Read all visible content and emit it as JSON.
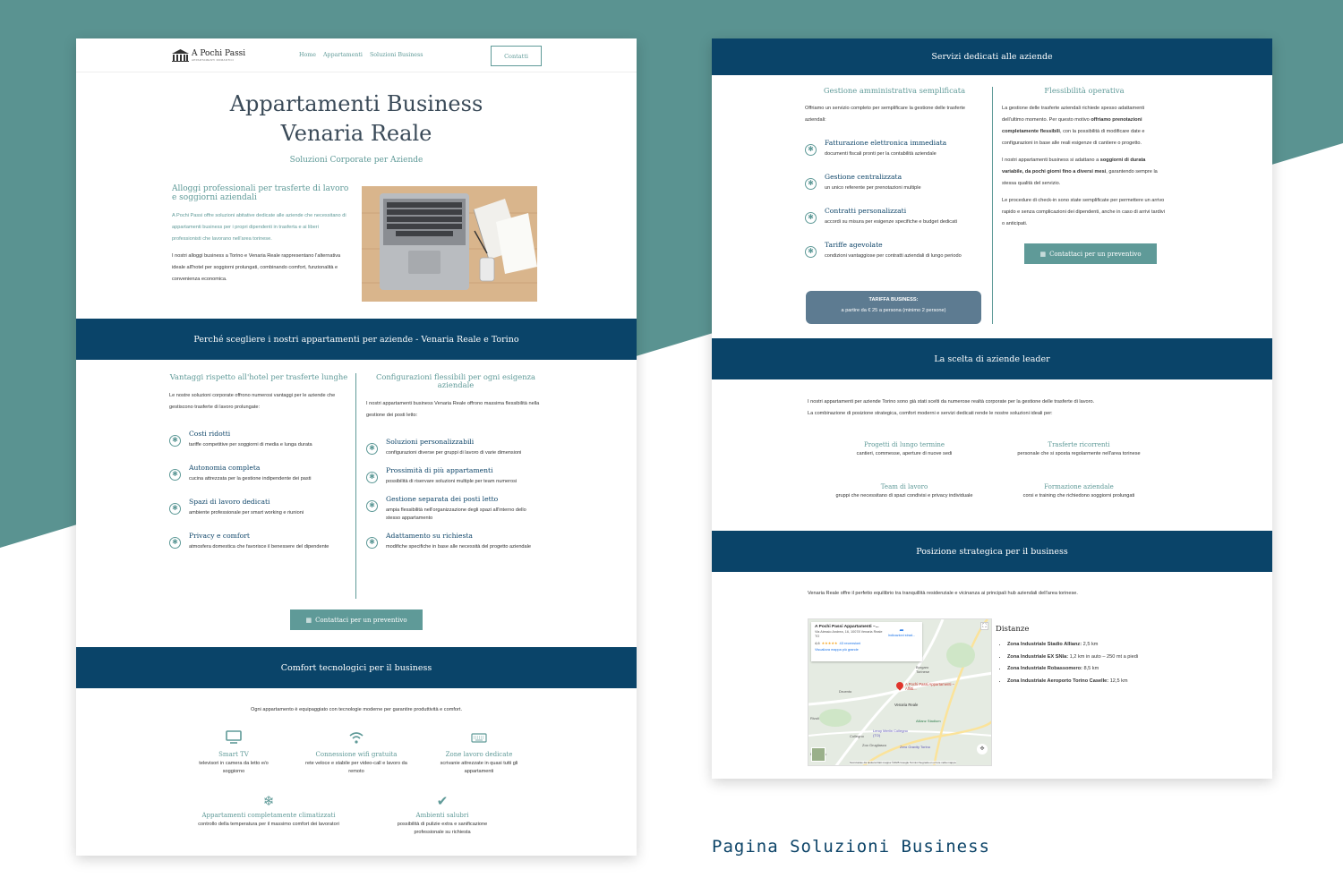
{
  "colors": {
    "navy": "#0a4469",
    "teal": "#5f9a98",
    "bg_teal": "#5a9391"
  },
  "left": {
    "logo": {
      "name": "A Pochi Passi",
      "tagline": "APPARTAMENTI ROMANTICI"
    },
    "nav": [
      "Home",
      "Appartamenti",
      "Soluzioni Business"
    ],
    "nav_button": "Contatti",
    "hero": {
      "title_line1": "Appartamenti Business",
      "title_line2": "Venaria Reale",
      "subtitle": "Soluzioni Corporate per Aziende"
    },
    "intro": {
      "heading": "Alloggi professionali per trasferte di lavoro e soggiorni aziendali",
      "p1": "A Pochi Passi offre soluzioni abitative dedicate alle aziende che necessitano di appartamenti business per i propri dipendenti in trasferta e ai liberi professionisti che lavorano nell'area torinese.",
      "p2": "I nostri alloggi business a Torino e Venaria Reale rappresentano l'alternativa ideale all'hotel per soggiorni prolungati, combinando comfort, funzionalità e convenienza economica."
    },
    "band1": "Perché scegliere i nostri appartamenti per aziende - Venaria Reale e Torino",
    "col1": {
      "title": "Vantaggi rispetto all'hotel per trasferte lunghe",
      "intro": "Le nostre soluzioni corporate offrono numerosi vantaggi per le aziende che gestiscono trasferte di lavoro prolungate:",
      "items": [
        {
          "title": "Costi ridotti",
          "desc": "tariffe competitive per soggiorni di media e lunga durata"
        },
        {
          "title": "Autonomia completa",
          "desc": "cucina attrezzata per la gestione indipendente dei pasti"
        },
        {
          "title": "Spazi di lavoro dedicati",
          "desc": "ambiente professionale per smart working e riunioni"
        },
        {
          "title": "Privacy e comfort",
          "desc": "atmosfera domestica che favorisce il benessere del dipendente"
        }
      ]
    },
    "col2": {
      "title": "Configurazioni flessibili per ogni esigenza aziendale",
      "intro": "I nostri appartamenti business Venaria Reale offrono massima flessibilità nella gestione dei posti letto:",
      "items": [
        {
          "title": "Soluzioni personalizzabili",
          "desc": "configurazioni diverse per gruppi di lavoro di varie dimensioni"
        },
        {
          "title": "Prossimità di più appartamenti",
          "desc": "possibilità di riservare soluzioni multiple per team numerosi"
        },
        {
          "title": "Gestione separata dei posti letto",
          "desc": "ampia flessibilità nell'organizzazione degli spazi all'interno dello stesso appartamento"
        },
        {
          "title": "Adattamento su richiesta",
          "desc": "modifiche specifiche in base alle necessità del progetto aziendale"
        }
      ]
    },
    "cta": "Contattaci per un preventivo",
    "band2": "Comfort tecnologici per il business",
    "comfort_intro": "Ogni appartamento è equipaggiato con tecnologie moderne per garantire produttività e comfort.",
    "comfort": [
      {
        "title": "Smart TV",
        "desc": "televisori in camera da letto e/o soggiorno",
        "icon": "tv-icon"
      },
      {
        "title": "Connessione wifi gratuita",
        "desc": "rete veloce e stabile per video-call e lavoro da remoto",
        "icon": "wifi-icon"
      },
      {
        "title": "Zone lavoro dedicate",
        "desc": "scrivanie attrezzate in quasi tutti gli appartamenti",
        "icon": "keyboard-icon"
      },
      {
        "title": "Appartamenti completamente climatizzati",
        "desc": "controllo della temperatura per il massimo comfort dei lavoratori",
        "icon": "snowflake-icon"
      },
      {
        "title": "Ambienti salubri",
        "desc": "possibilità di pulizie extra e sanificazione professionale su richiesta",
        "icon": "check-icon"
      }
    ]
  },
  "right": {
    "band1": "Servizi dedicati alle aziende",
    "colA": {
      "title": "Gestione amministrativa semplificata",
      "intro": "Offriamo un servizio completo per semplificare la gestione delle trasferte aziendali:",
      "items": [
        {
          "title": "Fatturazione elettronica immediata",
          "desc": "documenti fiscali pronti per la contabilità aziendale"
        },
        {
          "title": "Gestione centralizzata",
          "desc": "un unico referente per prenotazioni multiple"
        },
        {
          "title": "Contratti personalizzati",
          "desc": "accordi su misura per esigenze specifiche e budget dedicati"
        },
        {
          "title": "Tariffe agevolate",
          "desc": "condizioni vantaggiose per contratti aziendali di lungo periodo"
        }
      ],
      "tariff_title": "TARIFFA BUSINESS:",
      "tariff_text": "a partire da € 25 a persona (minimo 2 persone)"
    },
    "colB": {
      "title": "Flessibilità operativa",
      "p1a": "La gestione delle trasferte aziendali richiede spesso adattamenti dell'ultimo momento. Per questo motivo ",
      "p1b": "offriamo prenotazioni completamente flessibili",
      "p1c": ", con la possibilità di modificare date e configurazioni in base alle reali esigenze di cantiere o progetto.",
      "p2a": "I nostri appartamenti business si adattano a ",
      "p2b": "soggiorni di durata variabile, da pochi giorni fino a diversi mesi",
      "p2c": ", garantendo sempre la stessa qualità del servizio.",
      "p3": "Le procedure di check-in sono state semplificate per permettere un arrivo rapido e senza complicazioni dei dipendenti, anche in caso di arrivi tardivi o anticipati.",
      "cta": "Contattaci per un preventivo"
    },
    "band2": "La scelta di aziende leader",
    "leader_p1": "I nostri appartamenti per aziende Torino sono già stati scelti da numerose realtà corporate per la gestione delle trasferte di lavoro.",
    "leader_p2": "La combinazione di posizione strategica, comfort moderni e servizi dedicati rende le nostre soluzioni ideali per:",
    "leader_items": [
      {
        "title": "Progetti di lungo termine",
        "desc": "cantieri, commesse, aperture di nuove sedi"
      },
      {
        "title": "Trasferte ricorrenti",
        "desc": "personale che si sposta regolarmente nell'area torinese"
      },
      {
        "title": "Team di lavoro",
        "desc": "gruppi che necessitano di spazi condivisi e privacy individuale"
      },
      {
        "title": "Formazione aziendale",
        "desc": "corsi e training che richiedono soggiorni prolungati"
      }
    ],
    "band3": "Posizione strategica per il business",
    "position_text": "Venaria Reale offre il perfetto equilibrio tra tranquillità residenziale e vicinanza ai principali hub aziendali dell'area torinese.",
    "map": {
      "card_title": "A Pochi Passi Appartamenti –...",
      "card_addr": "Via Alessio Andrea, 16, 10078 Venaria Reale TO",
      "rating": "4,6",
      "stars": "★★★★★",
      "reviews": "43 recensioni",
      "directions": "Indicazioni strad...",
      "bigger_map": "Visualizza mappa più grande",
      "pin_label": "A Pochi Passi Appartamenti – Affitti...",
      "places": [
        "Rivoli",
        "Collegno",
        "Venaria Reale",
        "Borgaro Torinese",
        "Druento",
        "Piossasco",
        "Allianz Stadium",
        "Leroy Merlin Collegno (TO)",
        "Zoo Grugliasco",
        "Zero Gravity Torino"
      ],
      "footer": "Scorciatoie da tastiera   Dati mappa ©2025 Google   Termini   Segnala un errore nella mappa"
    },
    "distances_title": "Distanze",
    "distances": [
      {
        "name": "Zona Industriale Stadio Allianz:",
        "value": " 2,5 km"
      },
      {
        "name": "Zona Industriale EX SNIa:",
        "value": " 1,2 km in auto – 250 mt a piedi"
      },
      {
        "name": "Zona Industriale Robassomero:",
        "value": " 8,5 km"
      },
      {
        "name": "Zona Industriale Aeroporto Torino Caselle:",
        "value": " 12,5 km"
      }
    ]
  },
  "caption": "Pagina Soluzioni Business"
}
